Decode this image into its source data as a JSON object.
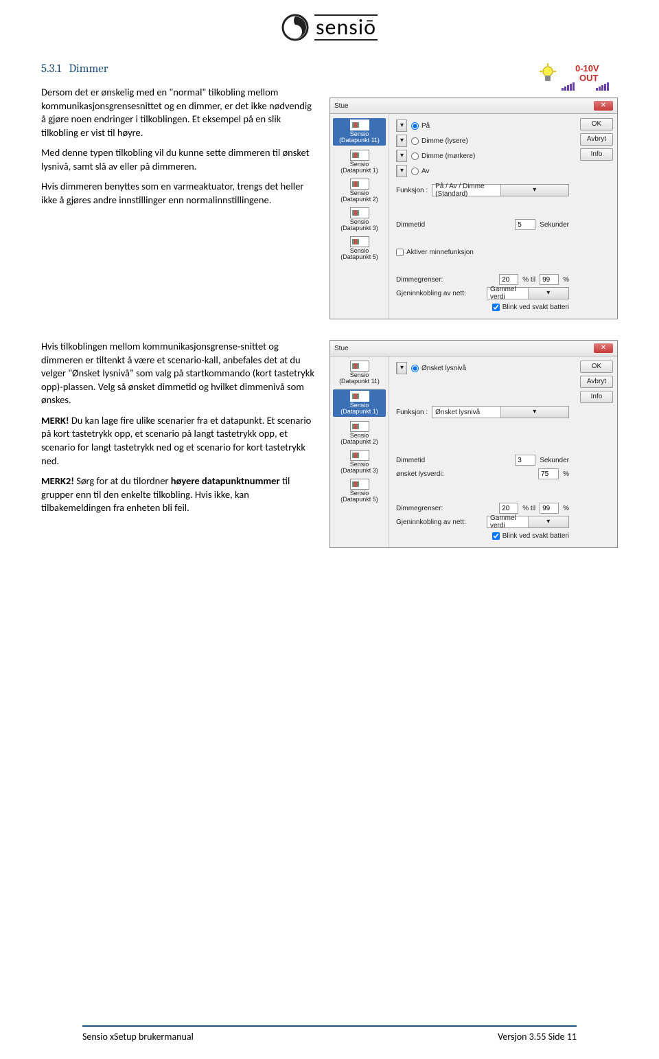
{
  "logo_text": "sensiō",
  "section_number": "5.3.1",
  "section_title": "Dimmer",
  "p1a": "Dersom det er ønskelig med en \"normal\" tilkobling mellom kommunikasjonsgrensesnittet og en dimmer, er det ikke nødvendig å gjøre noen endringer i tilkoblingen. Et eksempel på en slik tilkobling er vist til høyre.",
  "p1b": "Med denne typen tilkobling vil du kunne sette dimmeren til ønsket lysnivå, samt slå av eller på dimmeren.",
  "p1c": "Hvis dimmeren benyttes som en varmeaktuator, trengs det heller ikke å gjøres andre innstillinger enn normalinnstillingene.",
  "p2a": "Hvis tilkoblingen mellom kommunikasjonsgrense-snittet og dimmeren er tiltenkt å være et scenario-kall, anbefales det at du velger \"Ønsket lysnivå\" som valg på startkommando (kort tastetrykk opp)-plassen. Velg så ønsket dimmetid og hvilket dimmenivå som ønskes.",
  "p2b_label": "MERK!",
  "p2b": " Du kan lage fire ulike scenarier fra et datapunkt. Et scenario på kort tastetrykk opp, et scenario på langt tastetrykk opp, et scenario for langt tastetrykk ned og et scenario for kort tastetrykk ned.",
  "p2c_label": "MERK2!",
  "p2c": " Sørg for at du tilordner ",
  "p2c_bold": "høyere datapunktnummer",
  "p2c_rest": " til grupper enn til den enkelte tilkobling. Hvis ikke, kan tilbakemeldingen fra enheten bli feil.",
  "badge_volt": "0-10V",
  "badge_out": "OUT",
  "dlg1": {
    "title": "Stue",
    "btn_ok": "OK",
    "btn_cancel": "Avbryt",
    "btn_info": "Info",
    "dp": [
      {
        "top": "Sensio",
        "bot": "(Datapunkt 11)",
        "sel": true
      },
      {
        "top": "Sensio",
        "bot": "(Datapunkt 1)"
      },
      {
        "top": "Sensio",
        "bot": "(Datapunkt 2)"
      },
      {
        "top": "Sensio",
        "bot": "(Datapunkt 3)"
      },
      {
        "top": "Sensio",
        "bot": "(Datapunkt 5)"
      }
    ],
    "radios": [
      "På",
      "Dimme (lysere)",
      "Dimme (mørkere)",
      "Av"
    ],
    "funksjon_lbl": "Funksjon :",
    "funksjon_val": "På / Av / Dimme (Standard)",
    "dimmetid_lbl": "Dimmetid",
    "dimmetid_val": "5",
    "sekunder": "Sekunder",
    "chk_minne": "Aktiver minnefunksjon",
    "dimmegrenser_lbl": "Dimmegrenser:",
    "limit_lo": "20",
    "pct_til": "%  til",
    "limit_hi": "99",
    "pct": "%",
    "gjen_lbl": "Gjeninnkobling av nett:",
    "gjen_val": "Gammel verdi",
    "chk_blink": "Blink ved svakt batteri"
  },
  "dlg2": {
    "title": "Stue",
    "btn_ok": "OK",
    "btn_cancel": "Avbryt",
    "btn_info": "Info",
    "dp": [
      {
        "top": "Sensio",
        "bot": "(Datapunkt 11)"
      },
      {
        "top": "Sensio",
        "bot": "(Datapunkt 1)",
        "sel": true
      },
      {
        "top": "Sensio",
        "bot": "(Datapunkt 2)"
      },
      {
        "top": "Sensio",
        "bot": "(Datapunkt 3)"
      },
      {
        "top": "Sensio",
        "bot": "(Datapunkt 5)"
      }
    ],
    "radio1": "Ønsket lysnivå",
    "funksjon_lbl": "Funksjon :",
    "funksjon_val": "Ønsket lysnivå",
    "dimmetid_lbl": "Dimmetid",
    "dimmetid_val": "3",
    "sekunder": "Sekunder",
    "onsket_lbl": "ønsket lysverdi:",
    "onsket_val": "75",
    "pct": "%",
    "dimmegrenser_lbl": "Dimmegrenser:",
    "limit_lo": "20",
    "pct_til": "%  til",
    "limit_hi": "99",
    "gjen_lbl": "Gjeninnkobling av nett:",
    "gjen_val": "Gammel verdi",
    "chk_blink": "Blink ved svakt batteri"
  },
  "footer_left": "Sensio xSetup brukermanual",
  "footer_right": "Versjon 3.55  Side 11"
}
